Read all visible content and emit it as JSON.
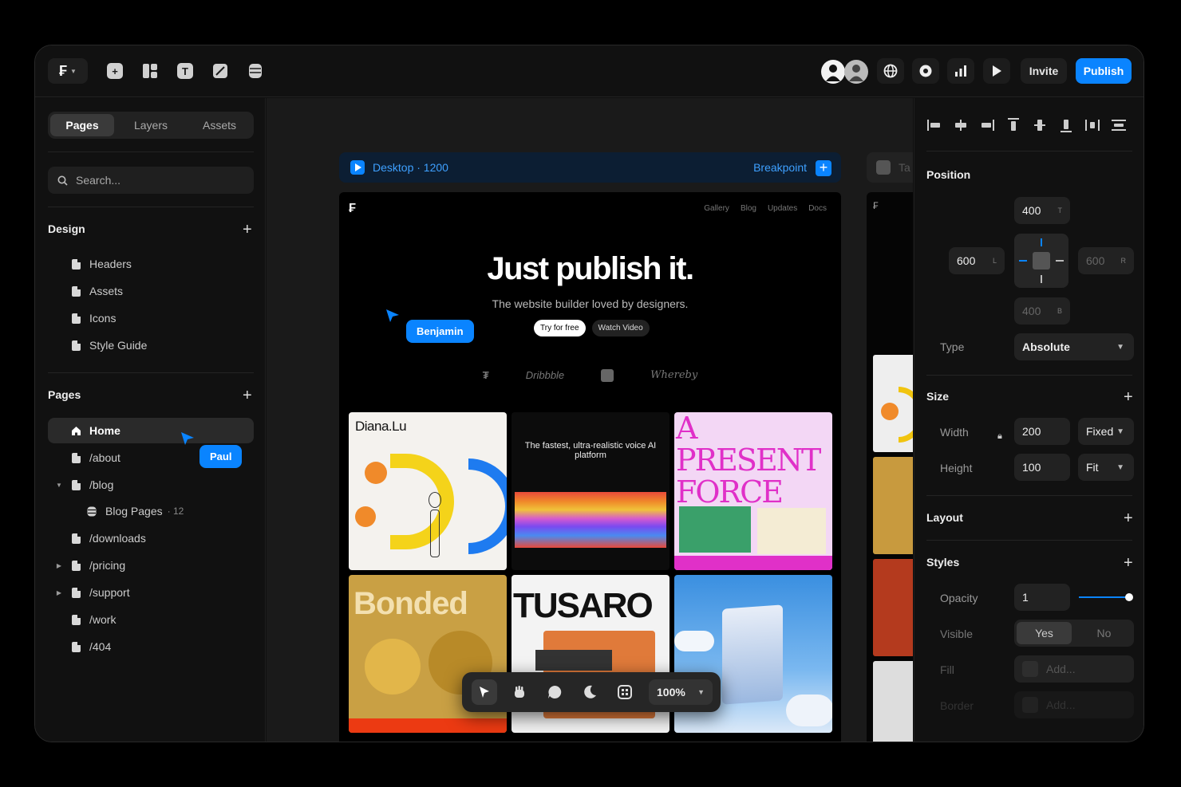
{
  "toolbar": {
    "invite_label": "Invite",
    "publish_label": "Publish",
    "accent": "#0a84ff"
  },
  "sidebar": {
    "tabs": [
      "Pages",
      "Layers",
      "Assets"
    ],
    "active_tab": "Pages",
    "search_placeholder": "Search...",
    "design_title": "Design",
    "design_items": [
      "Headers",
      "Assets",
      "Icons",
      "Style Guide"
    ],
    "pages_title": "Pages",
    "pages": [
      {
        "label": "Home",
        "icon": "home-icon",
        "active": true
      },
      {
        "label": "/about",
        "icon": "page-icon"
      },
      {
        "label": "/blog",
        "icon": "page-icon",
        "expanded": true
      },
      {
        "label": "Blog Pages",
        "icon": "database-icon",
        "count": "· 12"
      },
      {
        "label": "/downloads",
        "icon": "page-icon"
      },
      {
        "label": "/pricing",
        "icon": "page-icon",
        "collapsed": true
      },
      {
        "label": "/support",
        "icon": "page-icon",
        "collapsed": true
      },
      {
        "label": "/work",
        "icon": "page-icon"
      },
      {
        "label": "/404",
        "icon": "page-icon"
      }
    ]
  },
  "canvas": {
    "frame_label": "Desktop · 1200",
    "breakpoint_label": "Breakpoint",
    "tablet_label": "Ta",
    "site": {
      "nav": [
        "Gallery",
        "Blog",
        "Updates",
        "Docs"
      ],
      "hero_title": "Just publish it.",
      "hero_subtitle": "The website builder loved by designers.",
      "cta_primary": "Try for free",
      "cta_secondary": "Watch Video",
      "logos": [
        "Dribbble",
        "Whereby"
      ],
      "cards": [
        {
          "title": "Diana.Lu"
        },
        {
          "title": "The fastest, ultra-realistic voice AI platform"
        },
        {
          "title": "A PRESENT FORCE"
        },
        {
          "title": "Bonded"
        },
        {
          "title": "TUSARO"
        },
        {
          "title": ""
        }
      ]
    },
    "cursors": [
      {
        "name": "Benjamin"
      },
      {
        "name": "Paul"
      }
    ],
    "zoom": "100%"
  },
  "panel": {
    "position_title": "Position",
    "top": "400",
    "top_suffix": "T",
    "left": "600",
    "left_suffix": "L",
    "right": "600",
    "right_suffix": "R",
    "bottom": "400",
    "bottom_suffix": "B",
    "type_label": "Type",
    "type_value": "Absolute",
    "size_title": "Size",
    "width_label": "Width",
    "width_value": "200",
    "width_mode": "Fixed",
    "height_label": "Height",
    "height_value": "100",
    "height_mode": "Fit",
    "layout_title": "Layout",
    "styles_title": "Styles",
    "opacity_label": "Opacity",
    "opacity_value": "1",
    "visible_label": "Visible",
    "visible_yes": "Yes",
    "visible_no": "No",
    "fill_label": "Fill",
    "fill_placeholder": "Add...",
    "border_label": "Border",
    "border_placeholder": "Add..."
  }
}
